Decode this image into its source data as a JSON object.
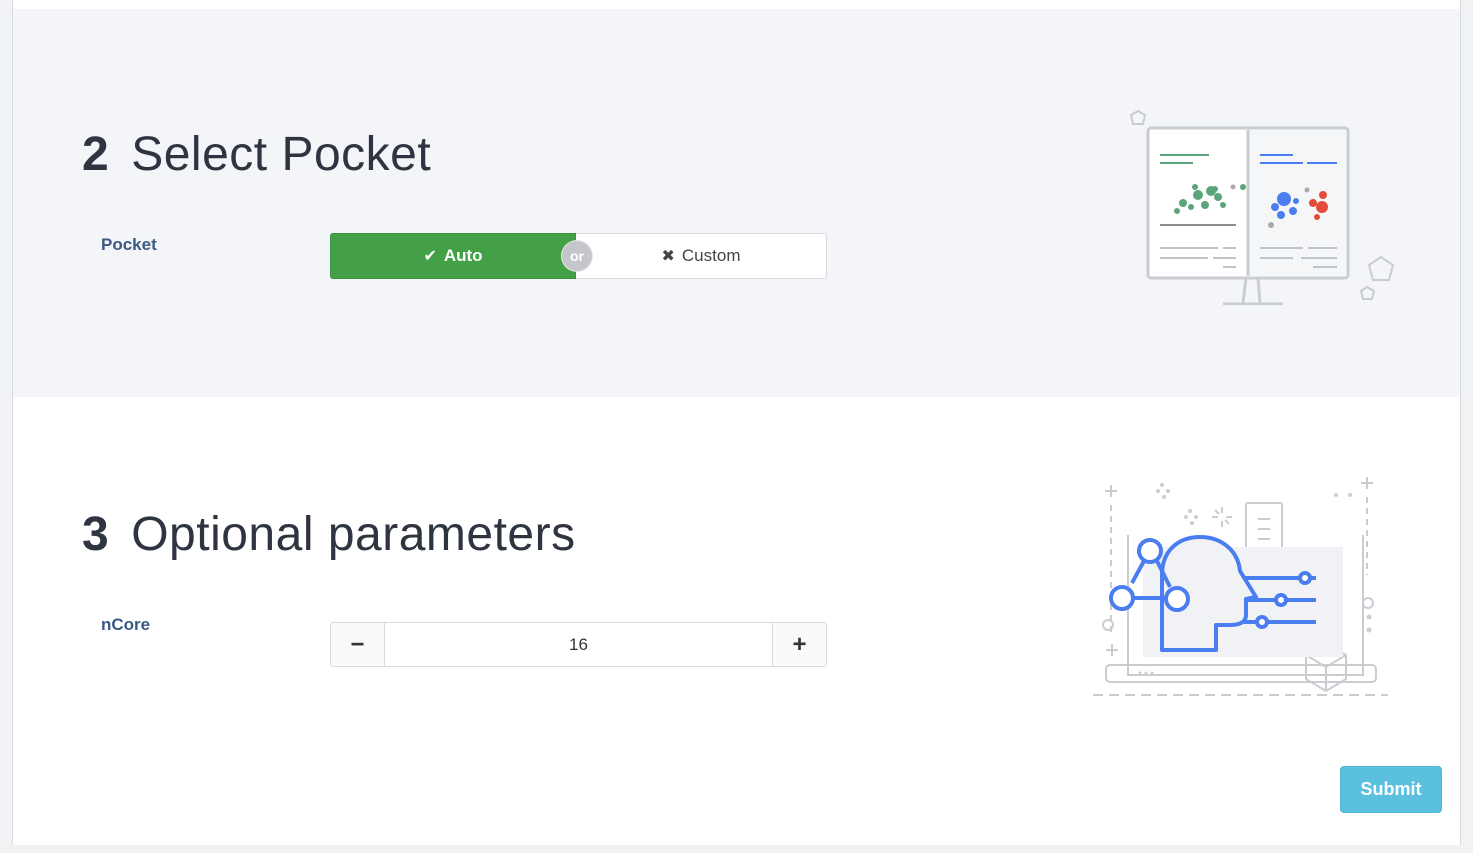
{
  "sections": [
    {
      "number": "2",
      "title": "Select Pocket",
      "field_label": "Pocket",
      "toggle": {
        "on_label": "Auto",
        "divider": "or",
        "off_label": "Custom",
        "selected": "Auto"
      }
    },
    {
      "number": "3",
      "title": "Optional parameters",
      "field_label": "nCore",
      "stepper": {
        "value": "16",
        "decrement": "−",
        "increment": "+"
      }
    }
  ],
  "submit_label": "Submit",
  "illustrations": [
    "dashboard-charts-illustration",
    "ai-settings-illustration"
  ],
  "colors": {
    "accent_green": "#43a047",
    "label_blue": "#3a5a84",
    "submit_blue": "#5bc0de",
    "illus_blue": "#4a7df0",
    "illus_green": "#5aa57a",
    "illus_red": "#e34b3b"
  }
}
